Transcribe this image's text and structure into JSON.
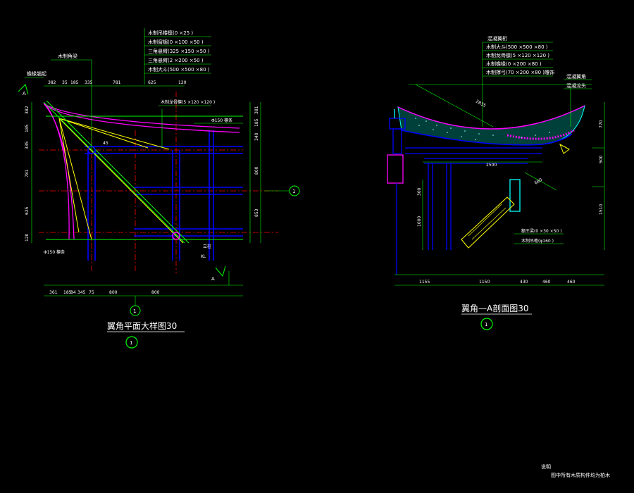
{
  "colors": {
    "bg": "#000000",
    "white": "#ffffff",
    "green": "#00ff00",
    "yellow": "#ffff00",
    "magenta": "#ff00ff",
    "red": "#ff0000",
    "cyan": "#00ffff",
    "blue": "#0000ff"
  },
  "plan": {
    "title": "翼角平面大样图30",
    "axis_mark": "1",
    "callouts": [
      "木制吊楼檩(0 ×25 )",
      "木制窗楣(0 ×100 ×50 )",
      "三角悬臂(325 ×150 ×50 )",
      "三角悬臂(2 ×200 ×50 )",
      "木制大斗(500 ×500 ×80 )"
    ],
    "left_callouts": [
      "檐椽翘起",
      "木制角梁"
    ],
    "side_labels": {
      "right_top": "木制龙骨檩(5 ×120 ×120 )",
      "rafter": "Φ150 檩条",
      "bottom_left": "Φ150 檩条",
      "post": "立柱",
      "kl": "KL",
      "section": "A",
      "angle": "45"
    },
    "top_dims": [
      "382",
      "35",
      "185",
      "335",
      "781",
      "625",
      "120"
    ],
    "left_dims": [
      "382",
      "185",
      "335",
      "781",
      "625",
      "120"
    ],
    "right_dims": [
      "381",
      "185",
      "340",
      "800",
      "853"
    ],
    "bottom_dims": [
      "361",
      "185",
      "84",
      "345",
      "75",
      "800",
      "800"
    ]
  },
  "section": {
    "title": "翼角—A剖面图30",
    "axis_mark": "1",
    "callouts": [
      "混凝翼桁",
      "木制大斗(500 ×500 ×80 )",
      "木制龙骨檩(5 ×120 ×120 )",
      "木制檐椽(0 ×200 ×80 )",
      "木制撑弓(70 ×200 ×80 )雕饰"
    ],
    "right_callouts": [
      "混凝翼角",
      "混凝龙头"
    ],
    "dims": {
      "diag": "2835",
      "span": "2500",
      "beam": "680",
      "h1": "300",
      "h2": "1000",
      "v1": "770",
      "v2": "500",
      "v3": "1510",
      "bottom": [
        "1155",
        "1150",
        "430",
        "460",
        "460"
      ]
    },
    "labels": {
      "beam": "额王梁(0 ×30 ×50 )",
      "column": "木制吊檐(φ160 )"
    }
  },
  "note": {
    "title": "说明",
    "text": "图中所有木质构件均为柏木"
  }
}
